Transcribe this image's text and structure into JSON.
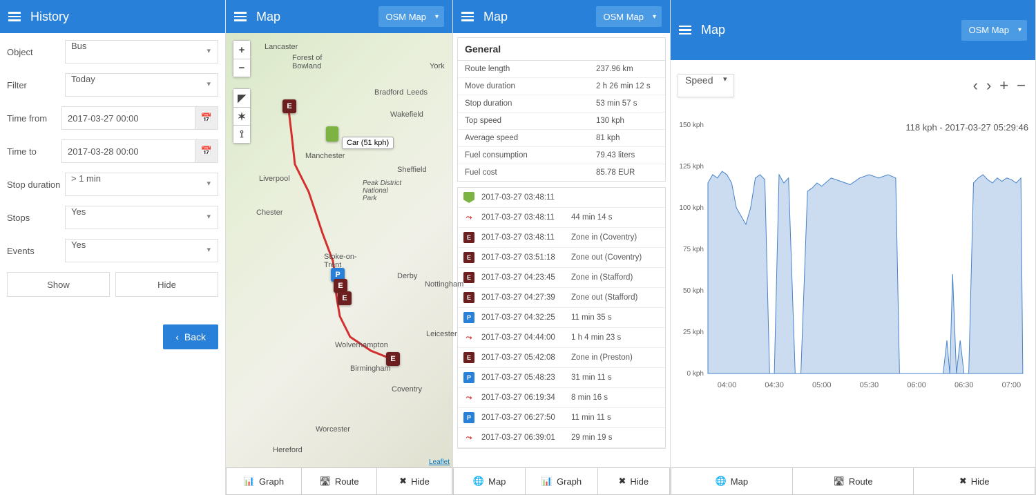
{
  "panels": {
    "history": {
      "title": "History"
    },
    "map1": {
      "title": "Map",
      "select": "OSM Map"
    },
    "map2": {
      "title": "Map",
      "select": "OSM Map"
    },
    "map3": {
      "title": "Map",
      "select": "OSM Map"
    }
  },
  "filters": {
    "object_lbl": "Object",
    "object_val": "Bus",
    "filter_lbl": "Filter",
    "filter_val": "Today",
    "from_lbl": "Time from",
    "from_val": "2017-03-27 00:00",
    "to_lbl": "Time to",
    "to_val": "2017-03-28 00:00",
    "stopdur_lbl": "Stop duration",
    "stopdur_val": "> 1 min",
    "stops_lbl": "Stops",
    "stops_val": "Yes",
    "events_lbl": "Events",
    "events_val": "Yes",
    "show": "Show",
    "hide": "Hide",
    "back": "Back"
  },
  "map": {
    "tooltip": "Car (51 kph)",
    "leaflet": "Leaflet",
    "cities": [
      "Lancaster",
      "Forest of Bowland",
      "York",
      "Bradford",
      "Leeds",
      "Wakefield",
      "Manchester",
      "Liverpool",
      "Sheffield",
      "Peak District National Park",
      "Chester",
      "Stoke-on-Trent",
      "Derby",
      "Nottingham",
      "Wolverhampton",
      "Birmingham",
      "Leicester",
      "Coventry",
      "Worcester",
      "Hereford"
    ]
  },
  "tabs2": {
    "graph": "Graph",
    "route": "Route",
    "hide": "Hide"
  },
  "tabs3": {
    "map": "Map",
    "graph": "Graph",
    "hide": "Hide"
  },
  "tabs4": {
    "map": "Map",
    "route": "Route",
    "hide": "Hide"
  },
  "general": {
    "title": "General",
    "rows": [
      {
        "k": "Route length",
        "v": "237.96 km"
      },
      {
        "k": "Move duration",
        "v": "2 h 26 min 12 s"
      },
      {
        "k": "Stop duration",
        "v": "53 min 57 s"
      },
      {
        "k": "Top speed",
        "v": "130 kph"
      },
      {
        "k": "Average speed",
        "v": "81 kph"
      },
      {
        "k": "Fuel consumption",
        "v": "79.43 liters"
      },
      {
        "k": "Fuel cost",
        "v": "85.78 EUR"
      }
    ]
  },
  "events": [
    {
      "ic": "start",
      "t": "2017-03-27 03:48:11",
      "d": ""
    },
    {
      "ic": "move",
      "t": "2017-03-27 03:48:11",
      "d": "44 min 14 s"
    },
    {
      "ic": "e",
      "t": "2017-03-27 03:48:11",
      "d": "Zone in (Coventry)"
    },
    {
      "ic": "e",
      "t": "2017-03-27 03:51:18",
      "d": "Zone out (Coventry)"
    },
    {
      "ic": "e",
      "t": "2017-03-27 04:23:45",
      "d": "Zone in (Stafford)"
    },
    {
      "ic": "e",
      "t": "2017-03-27 04:27:39",
      "d": "Zone out (Stafford)"
    },
    {
      "ic": "p",
      "t": "2017-03-27 04:32:25",
      "d": "11 min 35 s"
    },
    {
      "ic": "move",
      "t": "2017-03-27 04:44:00",
      "d": "1 h 4 min 23 s"
    },
    {
      "ic": "e",
      "t": "2017-03-27 05:42:08",
      "d": "Zone in (Preston)"
    },
    {
      "ic": "p",
      "t": "2017-03-27 05:48:23",
      "d": "31 min 11 s"
    },
    {
      "ic": "move",
      "t": "2017-03-27 06:19:34",
      "d": "8 min 16 s"
    },
    {
      "ic": "p",
      "t": "2017-03-27 06:27:50",
      "d": "11 min 11 s"
    },
    {
      "ic": "move",
      "t": "2017-03-27 06:39:01",
      "d": "29 min 19 s"
    }
  ],
  "chart_data": {
    "type": "area",
    "metric": "Speed",
    "tooltip": "118 kph - 2017-03-27 05:29:46",
    "ylabel": "kph",
    "ylim": [
      0,
      150
    ],
    "yticks": [
      0,
      25,
      50,
      75,
      100,
      125,
      150
    ],
    "xticks": [
      "04:00",
      "04:30",
      "05:00",
      "05:30",
      "06:00",
      "06:30",
      "07:00"
    ],
    "x": [
      3.8,
      3.85,
      3.9,
      3.95,
      4.0,
      4.05,
      4.1,
      4.15,
      4.2,
      4.25,
      4.3,
      4.35,
      4.4,
      4.45,
      4.5,
      4.55,
      4.6,
      4.65,
      4.72,
      4.78,
      4.85,
      4.9,
      4.95,
      5.0,
      5.1,
      5.2,
      5.3,
      5.4,
      5.5,
      5.6,
      5.7,
      5.78,
      5.82,
      5.9,
      6.0,
      6.1,
      6.2,
      6.28,
      6.32,
      6.35,
      6.38,
      6.42,
      6.46,
      6.5,
      6.55,
      6.6,
      6.65,
      6.7,
      6.75,
      6.8,
      6.85,
      6.9,
      6.95,
      7.0,
      7.05,
      7.1,
      7.12
    ],
    "values": [
      115,
      120,
      118,
      122,
      120,
      115,
      100,
      95,
      90,
      100,
      118,
      120,
      117,
      0,
      0,
      120,
      115,
      118,
      0,
      0,
      110,
      112,
      115,
      113,
      118,
      116,
      114,
      118,
      120,
      118,
      120,
      118,
      0,
      0,
      0,
      0,
      0,
      0,
      20,
      0,
      60,
      0,
      20,
      0,
      0,
      115,
      118,
      120,
      117,
      115,
      118,
      116,
      118,
      117,
      115,
      118,
      0
    ]
  }
}
